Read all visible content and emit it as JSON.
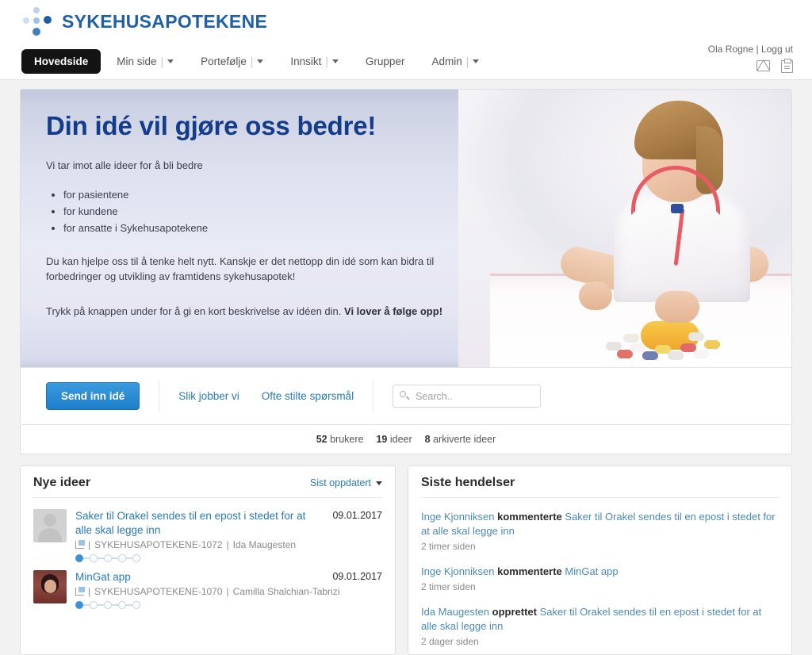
{
  "brand": {
    "name": "SYKEHUSAPOTEKENE"
  },
  "nav": {
    "items": [
      {
        "label": "Hovedside",
        "active": true,
        "dropdown": false
      },
      {
        "label": "Min side",
        "active": false,
        "dropdown": true
      },
      {
        "label": "Portefølje",
        "active": false,
        "dropdown": true
      },
      {
        "label": "Innsikt",
        "active": false,
        "dropdown": true
      },
      {
        "label": "Grupper",
        "active": false,
        "dropdown": false
      },
      {
        "label": "Admin",
        "active": false,
        "dropdown": true
      }
    ]
  },
  "user": {
    "name": "Ola Rogne",
    "separator": "|",
    "logout_label": "Logg ut",
    "icons": [
      "mail-icon",
      "clipboard-icon"
    ]
  },
  "hero": {
    "heading": "Din idé vil gjøre oss bedre!",
    "intro": "Vi tar imot alle ideer for å bli bedre",
    "bullets": [
      "for pasientene",
      "for kundene",
      "for ansatte i Sykehusapotekene"
    ],
    "paragraph1": "Du kan hjelpe oss til å tenke helt nytt. Kanskje er det nettopp din idé som kan bidra til forbedringer og utvikling av framtidens sykehusapotek!",
    "paragraph2_prefix": "Trykk på knappen under for å gi en kort beskrivelse av idéen din. ",
    "paragraph2_bold": "Vi lover å følge opp!",
    "image_alt": "girl-with-stethoscope-and-pills-photo"
  },
  "actionbar": {
    "submit_label": "Send inn idé",
    "links": [
      {
        "label": "Slik jobber vi"
      },
      {
        "label": "Ofte stilte spørsmål"
      }
    ],
    "search": {
      "value": "",
      "placeholder": "Search.."
    }
  },
  "stats": [
    {
      "count": "52",
      "label": "brukere"
    },
    {
      "count": "19",
      "label": "ideer"
    },
    {
      "count": "8",
      "label": "arkiverte ideer"
    }
  ],
  "ideas_panel": {
    "title": "Nye ideer",
    "sort_label": "Sist oppdatert",
    "items": [
      {
        "title": "Saker til Orakel sendes til en epost i stedet for at alle skal legge inn",
        "date": "09.01.2017",
        "ref": "SYKEHUSAPOTEKENE-1072",
        "author": "Ida Maugesten",
        "avatar": "generic",
        "steps_total": 5,
        "steps_done": 1
      },
      {
        "title": "MinGat app",
        "date": "09.01.2017",
        "ref": "SYKEHUSAPOTEKENE-1070",
        "author": "Camilla Shalchian-Tabrizi",
        "avatar": "photo",
        "steps_total": 5,
        "steps_done": 1
      }
    ]
  },
  "events_panel": {
    "title": "Siste hendelser",
    "items": [
      {
        "who": "Inge Kjonniksen",
        "verb": "kommenterte",
        "what": "Saker til Orakel sendes til en epost i stedet for at alle skal legge inn",
        "time": "2 timer siden"
      },
      {
        "who": "Inge Kjonniksen",
        "verb": "kommenterte",
        "what": "MinGat app",
        "time": "2 timer siden"
      },
      {
        "who": "Ida Maugesten",
        "verb": "opprettet",
        "what": "Saker til Orakel sendes til en epost i stedet for at alle skal legge inn",
        "time": "2 dager siden"
      }
    ]
  },
  "colors": {
    "brand_blue": "#1f5fa9",
    "heading_blue": "#133c8a",
    "link_blue": "#2a7ab8",
    "button_blue": "#1c7fc8",
    "nav_active_bg": "#141414"
  }
}
